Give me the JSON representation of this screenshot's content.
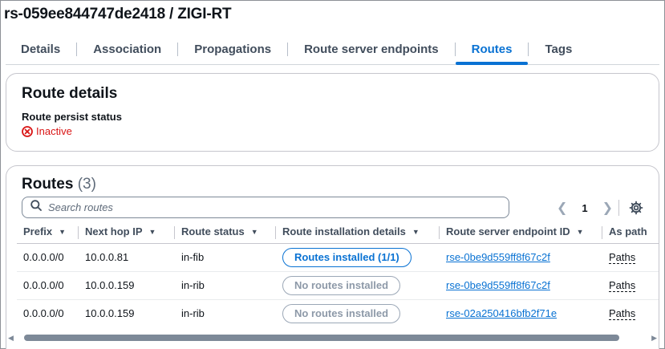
{
  "page": {
    "title": "rs-059ee844747de2418 / ZIGI-RT"
  },
  "tabs": [
    {
      "label": "Details"
    },
    {
      "label": "Association"
    },
    {
      "label": "Propagations"
    },
    {
      "label": "Route server endpoints"
    },
    {
      "label": "Routes",
      "active": true
    },
    {
      "label": "Tags"
    }
  ],
  "route_details": {
    "title": "Route details",
    "persist_label": "Route persist status",
    "persist_value": "Inactive",
    "status_color": "#d91515",
    "status_icon": "x-circle-icon"
  },
  "routes": {
    "title": "Routes",
    "count": "(3)",
    "search_placeholder": "Search routes",
    "page": "1",
    "columns": [
      "Prefix",
      "Next hop IP",
      "Route status",
      "Route installation details",
      "Route server endpoint ID",
      "As path"
    ],
    "rows": [
      {
        "prefix": "0.0.0.0/0",
        "next_hop": "10.0.0.81",
        "status": "in-fib",
        "install": "Routes installed (1/1)",
        "endpoint": "rse-0be9d559ff8f67c2f",
        "as_path": "Paths"
      },
      {
        "prefix": "0.0.0.0/0",
        "next_hop": "10.0.0.159",
        "status": "in-rib",
        "install": "No routes installed",
        "endpoint": "rse-0be9d559ff8f67c2f",
        "as_path": "Paths"
      },
      {
        "prefix": "0.0.0.0/0",
        "next_hop": "10.0.0.159",
        "status": "in-rib",
        "install": "No routes installed",
        "endpoint": "rse-02a250416bfb2f71e",
        "as_path": "Paths"
      }
    ]
  },
  "colors": {
    "accent": "#0972d3",
    "error": "#d91515"
  }
}
